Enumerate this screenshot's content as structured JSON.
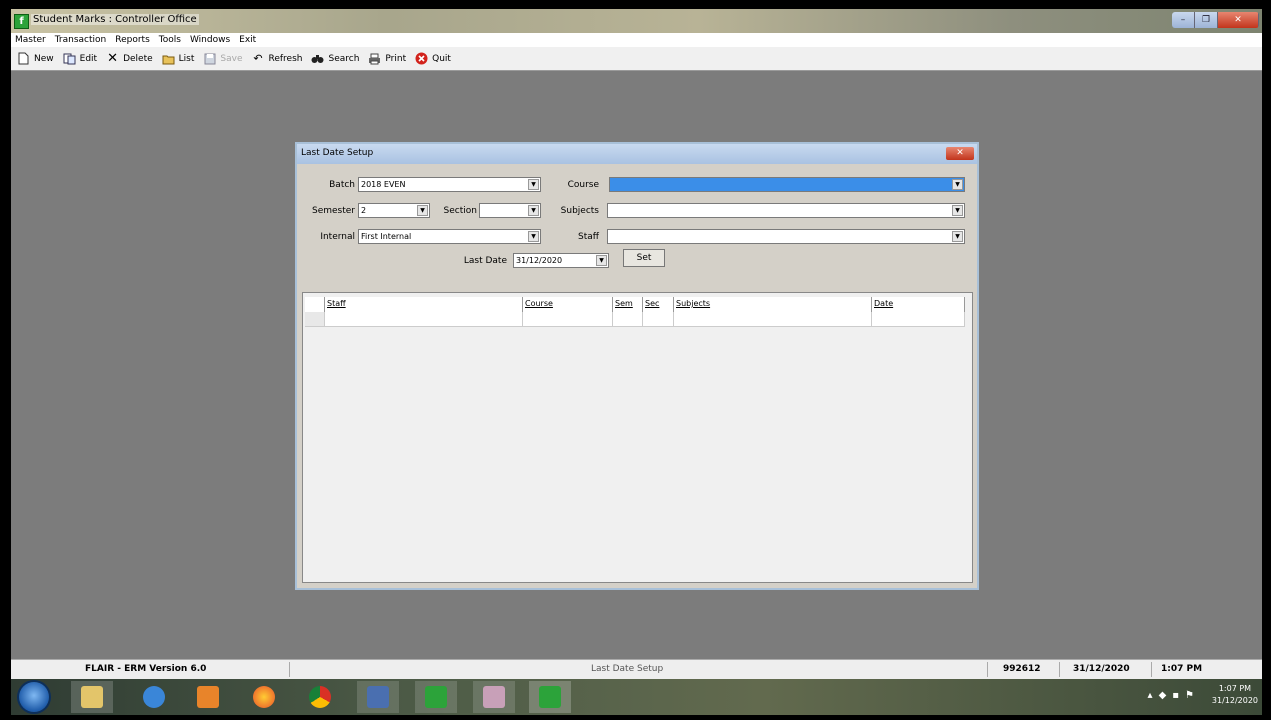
{
  "window": {
    "title": "Student Marks : Controller Office",
    "app_icon": "flair-f-icon"
  },
  "menu": [
    "Master",
    "Transaction",
    "Reports",
    "Tools",
    "Windows",
    "Exit"
  ],
  "toolbar": {
    "new": "New",
    "edit": "Edit",
    "delete": "Delete",
    "list": "List",
    "save": "Save",
    "refresh": "Refresh",
    "search": "Search",
    "print": "Print",
    "quit": "Quit"
  },
  "dialog": {
    "title": "Last Date Setup",
    "batch_label": "Batch",
    "batch_value": "2018 EVEN",
    "course_label": "Course",
    "course_value": "",
    "semester_label": "Semester",
    "semester_value": "2",
    "section_label": "Section",
    "section_value": "",
    "subjects_label": "Subjects",
    "subjects_value": "",
    "internal_label": "Internal",
    "internal_value": "First Internal",
    "staff_label": "Staff",
    "staff_value": "",
    "last_date_label": "Last Date",
    "last_date_value": "31/12/2020",
    "set_button": "Set"
  },
  "grid": {
    "columns": [
      "Staff",
      "Course",
      "Sem",
      "Sec",
      "Subjects",
      "Date"
    ]
  },
  "status": {
    "version": "FLAIR - ERM Version 6.0",
    "form": "Last Date Setup",
    "user_code": "992612",
    "date": "31/12/2020",
    "time": "1:07 PM"
  },
  "clock": {
    "time": "1:07 PM",
    "date": "31/12/2020"
  },
  "colors": {
    "desktop": "#7c7c7c",
    "selection": "#3b8ee8",
    "dialog_bg": "#d4d0c8"
  }
}
